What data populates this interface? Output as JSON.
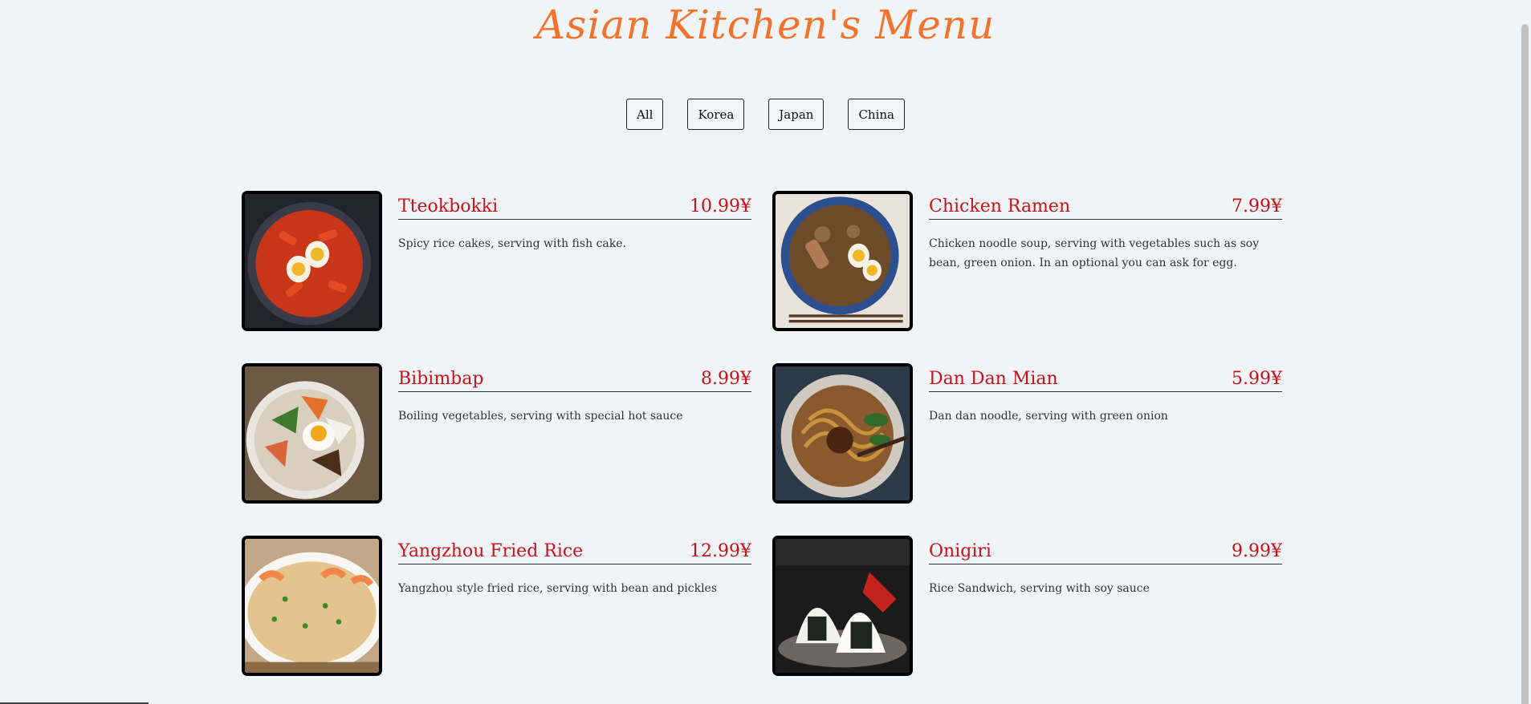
{
  "header": {
    "title": "Asian Kitchen's Menu"
  },
  "filters": [
    "All",
    "Korea",
    "Japan",
    "China"
  ],
  "menu": {
    "items": [
      {
        "name": "Tteokbokki",
        "price": "10.99¥",
        "desc": "Spicy rice cakes, serving with fish cake."
      },
      {
        "name": "Chicken Ramen",
        "price": "7.99¥",
        "desc": "Chicken noodle soup, serving with vegetables such as soy bean, green onion. In an optional you can ask for egg."
      },
      {
        "name": "Bibimbap",
        "price": "8.99¥",
        "desc": "Boiling vegetables, serving with special hot sauce"
      },
      {
        "name": "Dan Dan Mian",
        "price": "5.99¥",
        "desc": "Dan dan noodle, serving with green onion"
      },
      {
        "name": "Yangzhou Fried Rice",
        "price": "12.99¥",
        "desc": "Yangzhou style fried rice, serving with bean and pickles"
      },
      {
        "name": "Onigiri",
        "price": "9.99¥",
        "desc": "Rice Sandwich, serving with soy sauce"
      }
    ]
  },
  "colors": {
    "title": "#f0742e",
    "accent": "#c4131a",
    "background": "#f1f4f7"
  }
}
